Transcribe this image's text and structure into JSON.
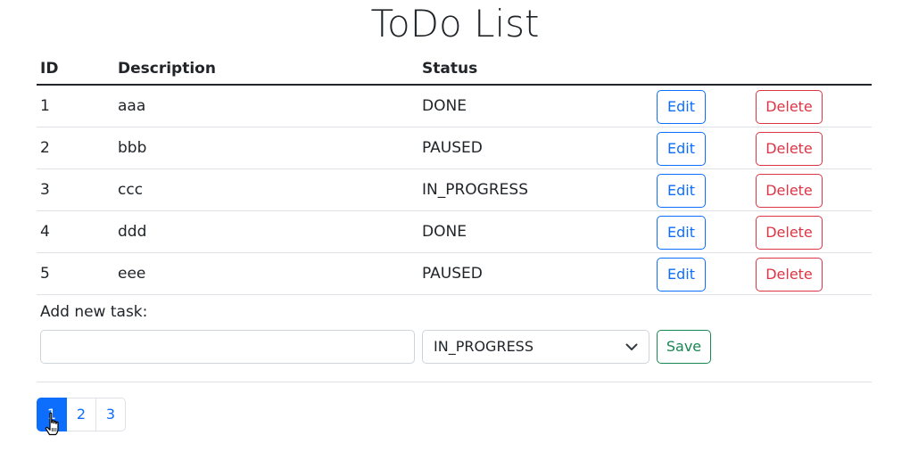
{
  "title": "ToDo List",
  "table": {
    "headers": {
      "id": "ID",
      "description": "Description",
      "status": "Status"
    },
    "rows": [
      {
        "id": "1",
        "description": "aaa",
        "status": "DONE",
        "edit": "Edit",
        "delete": "Delete"
      },
      {
        "id": "2",
        "description": "bbb",
        "status": "PAUSED",
        "edit": "Edit",
        "delete": "Delete"
      },
      {
        "id": "3",
        "description": "ccc",
        "status": "IN_PROGRESS",
        "edit": "Edit",
        "delete": "Delete"
      },
      {
        "id": "4",
        "description": "ddd",
        "status": "DONE",
        "edit": "Edit",
        "delete": "Delete"
      },
      {
        "id": "5",
        "description": "eee",
        "status": "PAUSED",
        "edit": "Edit",
        "delete": "Delete"
      }
    ]
  },
  "add_task": {
    "label": "Add new task:",
    "input_value": "",
    "input_placeholder": "",
    "status_selected": "IN_PROGRESS",
    "save_label": "Save"
  },
  "pagination": {
    "pages": [
      "1",
      "2",
      "3"
    ],
    "active": "1"
  },
  "icons": {
    "select": "chevron-down-icon",
    "cursor": "hand-pointer-icon"
  },
  "colors": {
    "primary": "#0d6efd",
    "danger": "#dc3545",
    "success": "#198754"
  }
}
